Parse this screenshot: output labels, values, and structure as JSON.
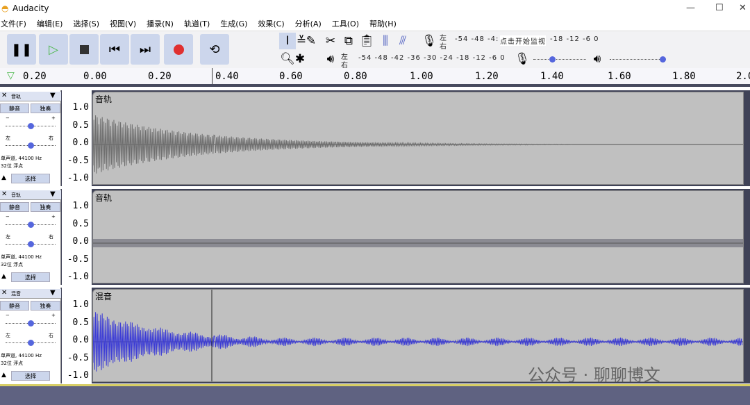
{
  "app": {
    "title": "Audacity"
  },
  "menu": [
    "文件(F)",
    "编辑(E)",
    "选择(S)",
    "视图(V)",
    "播录(N)",
    "轨道(T)",
    "生成(G)",
    "效果(C)",
    "分析(A)",
    "工具(O)",
    "帮助(H)"
  ],
  "meters": {
    "rec_lr": [
      "左",
      "右"
    ],
    "rec_scale": "-54 -48 -4: ",
    "rec_hint": "点击开始监视",
    "rec_scale2": "-18 -12 -6 0",
    "play_lr": [
      "左",
      "右"
    ],
    "play_scale": "-54 -48 -42 -36 -30 -24 -18 -12 -6 0"
  },
  "mixer": {
    "rec_volume": 0.35,
    "play_volume": 1.0
  },
  "ruler": [
    "0.20",
    "0.00",
    "0.20",
    "0.40",
    "0.60",
    "0.80",
    "1.00",
    "1.20",
    "1.40",
    "1.60",
    "1.80",
    "2.0"
  ],
  "tracks": [
    {
      "name": "音轨",
      "mute": "静音",
      "solo": "独奏",
      "left": "左",
      "right": "右",
      "info1": "单声道, 44100 Hz",
      "info2": "32位 浮点",
      "select": "选择",
      "scale": [
        "1.0",
        "0.5",
        "0.0",
        "-0.5",
        "-1.0"
      ],
      "color": "#6e6e6e",
      "gain": 0.5,
      "pan": 0.5
    },
    {
      "name": "音轨",
      "mute": "静音",
      "solo": "独奏",
      "left": "左",
      "right": "右",
      "info1": "单声道, 44100 Hz",
      "info2": "32位 浮点",
      "select": "选择",
      "scale": [
        "1.0",
        "0.5",
        "0.0",
        "-0.5",
        "-1.0"
      ],
      "color": "#8a8a92",
      "gain": 0.5,
      "pan": 0.5
    },
    {
      "name": "混音",
      "mute": "静音",
      "solo": "独奏",
      "left": "左",
      "right": "右",
      "info1": "单声道, 44100 Hz",
      "info2": "32位 浮点",
      "select": "选择",
      "scale": [
        "1.0",
        "0.5",
        "0.0",
        "-0.5",
        "-1.0"
      ],
      "color": "#3b3bd6",
      "gain": 0.5,
      "pan": 0.5
    }
  ],
  "watermark": "公众号 · 聊聊博文"
}
